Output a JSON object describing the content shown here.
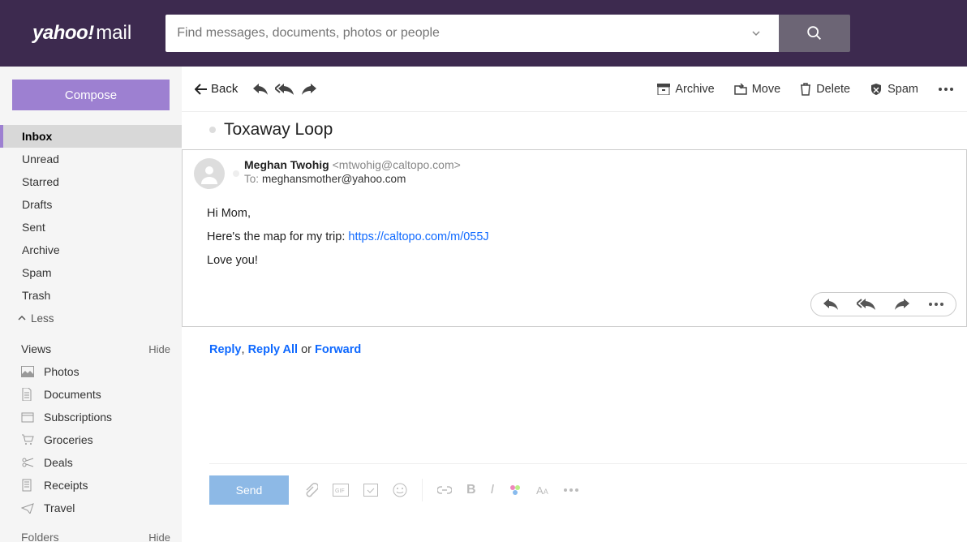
{
  "header": {
    "logo_yahoo": "yahoo",
    "logo_bang": "!",
    "logo_mail": "mail",
    "search_placeholder": "Find messages, documents, photos or people"
  },
  "sidebar": {
    "compose_label": "Compose",
    "folders": [
      {
        "label": "Inbox",
        "active": true
      },
      {
        "label": "Unread",
        "active": false
      },
      {
        "label": "Starred",
        "active": false
      },
      {
        "label": "Drafts",
        "active": false
      },
      {
        "label": "Sent",
        "active": false
      },
      {
        "label": "Archive",
        "active": false
      },
      {
        "label": "Spam",
        "active": false
      },
      {
        "label": "Trash",
        "active": false
      }
    ],
    "less_label": "Less",
    "views_header": "Views",
    "hide_label": "Hide",
    "views": [
      {
        "label": "Photos",
        "icon": "photo-icon"
      },
      {
        "label": "Documents",
        "icon": "document-icon"
      },
      {
        "label": "Subscriptions",
        "icon": "subscriptions-icon"
      },
      {
        "label": "Groceries",
        "icon": "cart-icon"
      },
      {
        "label": "Deals",
        "icon": "scissors-icon"
      },
      {
        "label": "Receipts",
        "icon": "receipt-icon"
      },
      {
        "label": "Travel",
        "icon": "plane-icon"
      }
    ],
    "folders_header": "Folders"
  },
  "toolbar": {
    "back_label": "Back",
    "archive_label": "Archive",
    "move_label": "Move",
    "delete_label": "Delete",
    "spam_label": "Spam"
  },
  "message": {
    "subject": "Toxaway Loop",
    "from_name": "Meghan Twohig",
    "from_email": "<mtwohig@caltopo.com>",
    "to_label": "To:",
    "to_email": "meghansmother@yahoo.com",
    "body_line1": "Hi Mom,",
    "body_line2_pre": "Here's the map for my trip: ",
    "body_link": "https://caltopo.com/m/055J",
    "body_line3": "Love you!"
  },
  "reply_row": {
    "reply": "Reply",
    "comma": ", ",
    "reply_all": "Reply All",
    "or": " or ",
    "forward": "Forward"
  },
  "compose_bar": {
    "send_label": "Send"
  }
}
